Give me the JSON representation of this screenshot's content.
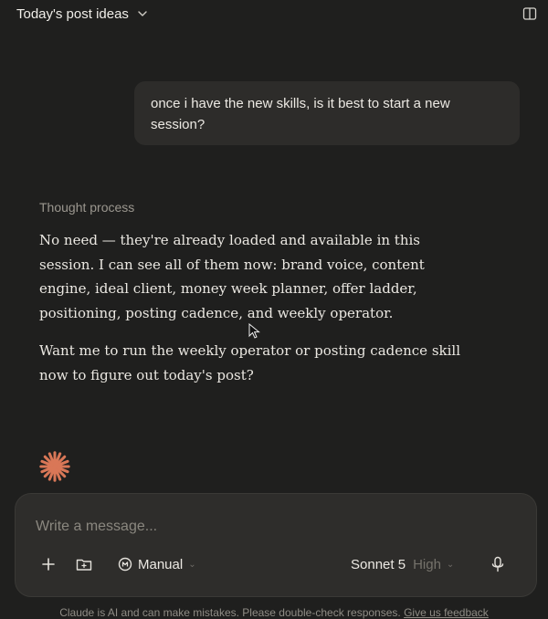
{
  "header": {
    "title": "Today's post ideas",
    "title_icon": "chevron-down-icon",
    "toggle_icon": "sidebar-toggle-icon"
  },
  "conversation": {
    "user_message": "once i have the new skills, is it best to start a new session?",
    "thought_label": "Thought process",
    "reply_paragraphs": [
      "No need — they're already loaded and available in this session. I can see all of them now: brand voice, content engine, ideal client, money week planner, offer ladder, positioning, posting cadence, and weekly operator.",
      "Want me to run the weekly operator or posting cadence skill now to figure out today's post?"
    ],
    "avatar_icon": "claude-spark-icon",
    "accent_color": "#d97757"
  },
  "composer": {
    "placeholder": "Write a message...",
    "mode_label": "Manual",
    "model_label": "Sonnet 5",
    "effort_label": "High"
  },
  "footer": {
    "disclaimer": "Claude is AI and can make mistakes. Please double-check responses.",
    "feedback_link": "Give us feedback"
  }
}
